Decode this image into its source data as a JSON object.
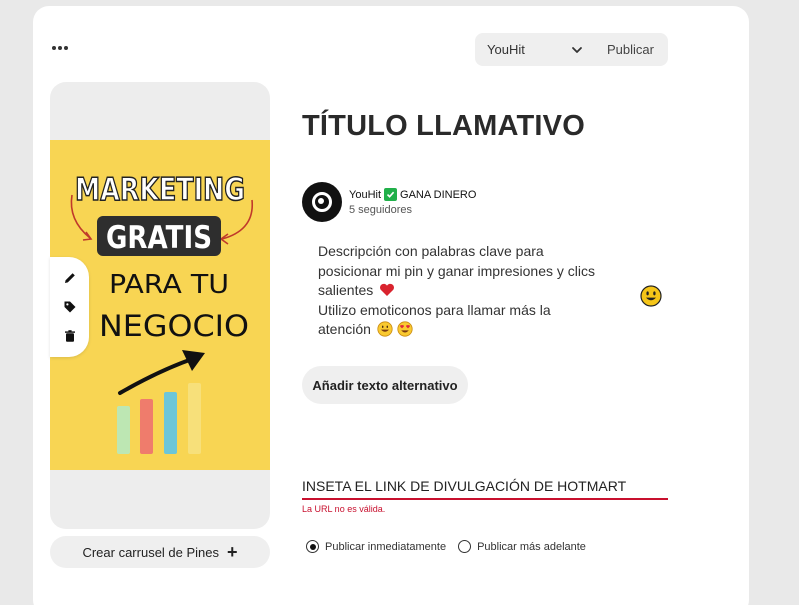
{
  "header": {
    "more_icon": "more-horizontal-icon",
    "board": {
      "name": "YouHit",
      "icon": "chevron-down-icon"
    },
    "publish_label": "Publicar"
  },
  "media": {
    "poster": {
      "line1": "MARKETING",
      "line2": "GRATIS",
      "line3": "PARA TU",
      "line4": "NEGOCIO",
      "background": "#f8d553",
      "bar_colors": [
        "#bde7b3",
        "#ef7c6c",
        "#6cc6d8",
        "#f7e07a"
      ]
    },
    "tools": [
      "pencil-icon",
      "tag-icon",
      "trash-icon"
    ],
    "carousel_label": "Crear carrusel de Pines",
    "carousel_icon": "plus-icon"
  },
  "pin": {
    "title": "TÍTULO LLAMATIVO",
    "profile": {
      "name": "YouHit",
      "verified_icon": "check-box-icon",
      "tagline": "GANA DINERO",
      "followers": "5 seguidores"
    },
    "description_lines": [
      "Descripción con palabras clave para",
      "posicionar mi pin y ganar impresiones y clics",
      "salientes",
      "Utilizo emoticonos para llamar más la",
      "atención"
    ],
    "description_emojis": [
      "heart-emoji",
      "grinning-emoji",
      "heart-eyes-emoji",
      "smiley-emoji"
    ],
    "alt_text_label": "Añadir texto alternativo",
    "link_value": "INSETA EL LINK DE DIVULGACIÓN DE HOTMART",
    "link_error": "La URL no es válida.",
    "publish_options": [
      {
        "label": "Publicar inmediatamente",
        "selected": true
      },
      {
        "label": "Publicar más adelante",
        "selected": false
      }
    ]
  },
  "colors": {
    "background": "#e9e9e9",
    "card": "#ffffff",
    "error": "#c8102e",
    "verified": "#21b04a",
    "button_bg": "#efefef"
  }
}
